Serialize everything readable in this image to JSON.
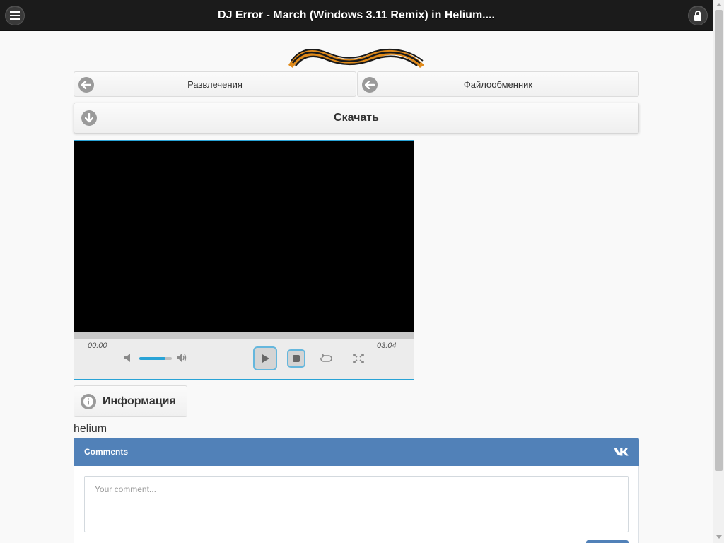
{
  "header": {
    "title": "DJ Error - March (Windows 3.11 Remix) in Helium....",
    "menu_icon": "hamburger-icon",
    "lock_icon": "lock-icon"
  },
  "nav": {
    "left_label": "Развлечения",
    "right_label": "Файлообменник",
    "back_icon": "arrow-left-icon"
  },
  "download": {
    "label": "Скачать",
    "icon": "arrow-down-icon"
  },
  "player": {
    "current_time": "00:00",
    "duration": "03:04",
    "progress": 0,
    "volume": 0.8
  },
  "info": {
    "label": "Информация",
    "icon": "info-icon"
  },
  "description": "helium",
  "comments": {
    "title": "Comments",
    "placeholder": "Your comment..."
  },
  "colors": {
    "header_bg": "#1b1b1b",
    "accent": "#29a3d6",
    "vk_blue": "#5181b8"
  }
}
